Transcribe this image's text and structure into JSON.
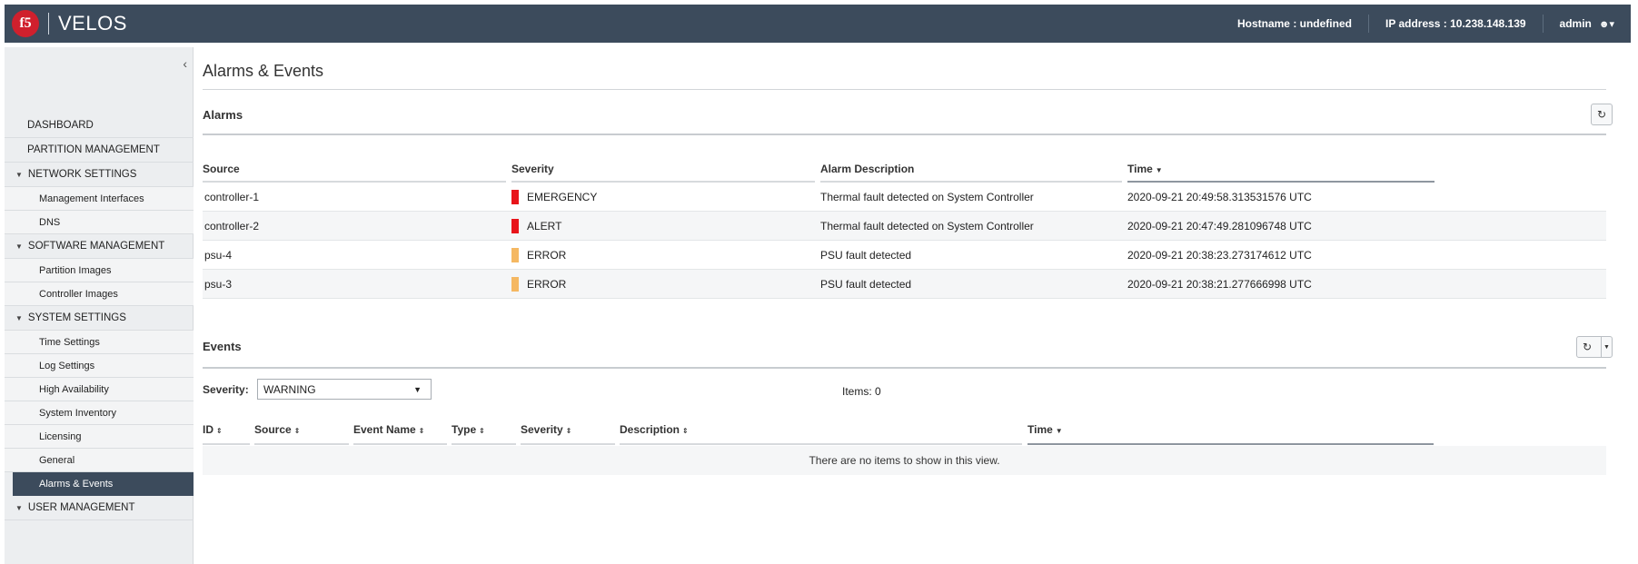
{
  "header": {
    "logo_text": "f5",
    "app_name": "VELOS",
    "hostname": "Hostname : undefined",
    "ip_address": "IP address : 10.238.148.139",
    "user": "admin"
  },
  "sidebar": {
    "collapse_glyph": "‹",
    "items": [
      {
        "label": "DASHBOARD"
      },
      {
        "label": "PARTITION MANAGEMENT"
      },
      {
        "label": "NETWORK SETTINGS"
      },
      {
        "label": "Management Interfaces"
      },
      {
        "label": "DNS"
      },
      {
        "label": "SOFTWARE MANAGEMENT"
      },
      {
        "label": "Partition Images"
      },
      {
        "label": "Controller Images"
      },
      {
        "label": "SYSTEM SETTINGS"
      },
      {
        "label": "Time Settings"
      },
      {
        "label": "Log Settings"
      },
      {
        "label": "High Availability"
      },
      {
        "label": "System Inventory"
      },
      {
        "label": "Licensing"
      },
      {
        "label": "General"
      },
      {
        "label": "Alarms & Events"
      },
      {
        "label": "USER MANAGEMENT"
      }
    ]
  },
  "main": {
    "title": "Alarms & Events",
    "alarms": {
      "title": "Alarms",
      "refresh_glyph": "↻",
      "columns": [
        "Source",
        "Severity",
        "Alarm Description",
        "Time"
      ],
      "rows": [
        {
          "source": "controller-1",
          "severity": "EMERGENCY",
          "severity_color": "#e8141a",
          "description": "Thermal fault detected on System Controller",
          "time": "2020-09-21 20:49:58.313531576 UTC"
        },
        {
          "source": "controller-2",
          "severity": "ALERT",
          "severity_color": "#e8141a",
          "description": "Thermal fault detected on System Controller",
          "time": "2020-09-21 20:47:49.281096748 UTC"
        },
        {
          "source": "psu-4",
          "severity": "ERROR",
          "severity_color": "#f5b862",
          "description": "PSU fault detected",
          "time": "2020-09-21 20:38:23.273174612 UTC"
        },
        {
          "source": "psu-3",
          "severity": "ERROR",
          "severity_color": "#f5b862",
          "description": "PSU fault detected",
          "time": "2020-09-21 20:38:21.277666998 UTC"
        }
      ]
    },
    "events": {
      "title": "Events",
      "refresh_glyph": "↻",
      "severity_label": "Severity:",
      "severity_value": "WARNING",
      "items_count": "Items: 0",
      "columns": [
        "ID",
        "Source",
        "Event Name",
        "Type",
        "Severity",
        "Description",
        "Time"
      ],
      "empty_message": "There are no items to show in this view."
    }
  }
}
